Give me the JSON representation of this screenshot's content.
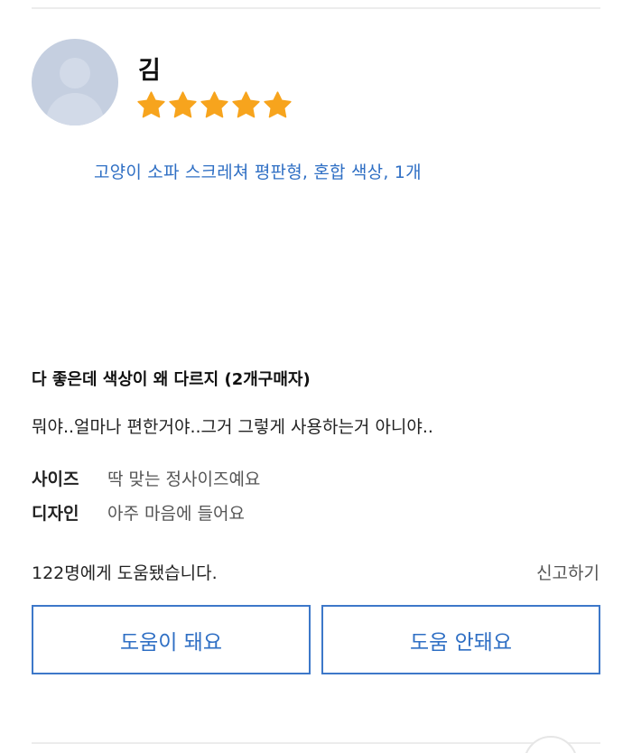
{
  "review": {
    "reviewer_name": "김",
    "rating": 5,
    "rating_max": 5,
    "star_color": "#f7a41d",
    "product_option": "고양이 소파 스크레쳐 평판형, 혼합 색상, 1개",
    "headline": "다 좋은데 색상이 왜 다르지 (2개구매자)",
    "body": "뭐야..얼마나 편한거야..그거 그렇게 사용하는거 아니야..",
    "attributes": [
      {
        "key": "사이즈",
        "value": "딱 맞는 정사이즈예요"
      },
      {
        "key": "디자인",
        "value": "아주 마음에 들어요"
      }
    ],
    "helpful_text": "122명에게 도움됐습니다.",
    "report_label": "신고하기",
    "helpful_button": "도움이 돼요",
    "not_helpful_button": "도움 안돼요",
    "accent_color": "#2f6fc4"
  },
  "icons": {
    "avatar": "default-user-avatar-icon",
    "star": "star-icon"
  }
}
